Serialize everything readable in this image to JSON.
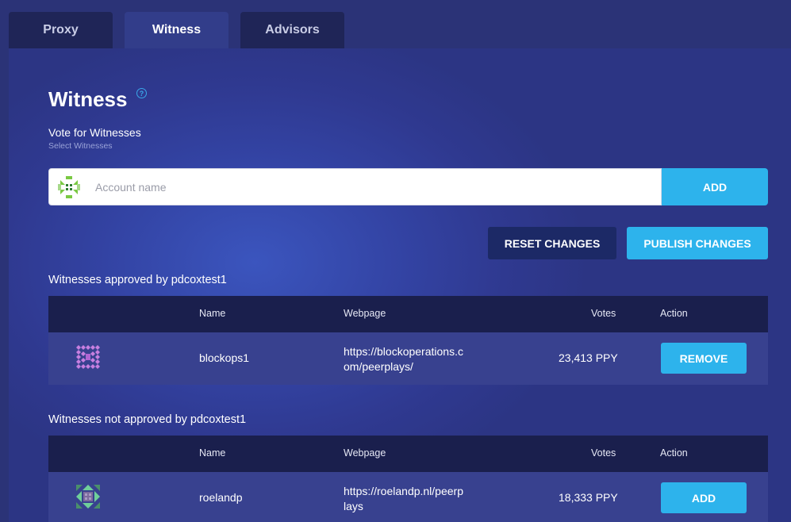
{
  "tabs": [
    {
      "label": "Proxy"
    },
    {
      "label": "Witness"
    },
    {
      "label": "Advisors"
    }
  ],
  "page": {
    "title": "Witness",
    "subtitle": "Vote for Witnesses",
    "sub_subtitle": "Select Witnesses"
  },
  "search": {
    "placeholder": "Account name",
    "value": "",
    "add_label": "ADD"
  },
  "actions": {
    "reset_label": "RESET CHANGES",
    "publish_label": "PUBLISH CHANGES"
  },
  "approved": {
    "label": "Witnesses approved by pdcoxtest1",
    "columns": [
      "Name",
      "Webpage",
      "Votes",
      "Action"
    ],
    "rows": [
      {
        "name": "blockops1",
        "webpage_line1": "https://blockoperations.c",
        "webpage_line2": "om/peerplays/",
        "votes": "23,413 PPY",
        "action": "REMOVE"
      }
    ]
  },
  "not_approved": {
    "label": "Witnesses not approved by pdcoxtest1",
    "columns": [
      "Name",
      "Webpage",
      "Votes",
      "Action"
    ],
    "rows": [
      {
        "name": "roelandp",
        "webpage_line1": "https://roelandp.nl/peerp",
        "webpage_line2": "lays",
        "votes": "18,333 PPY",
        "action": "ADD"
      }
    ]
  },
  "colors": {
    "accent": "#2db3ec",
    "navy_button": "#1c2966",
    "table_header": "#1a1f4d",
    "table_row": "#38418f"
  },
  "icons": [
    "help-icon",
    "identicon-avatar"
  ]
}
